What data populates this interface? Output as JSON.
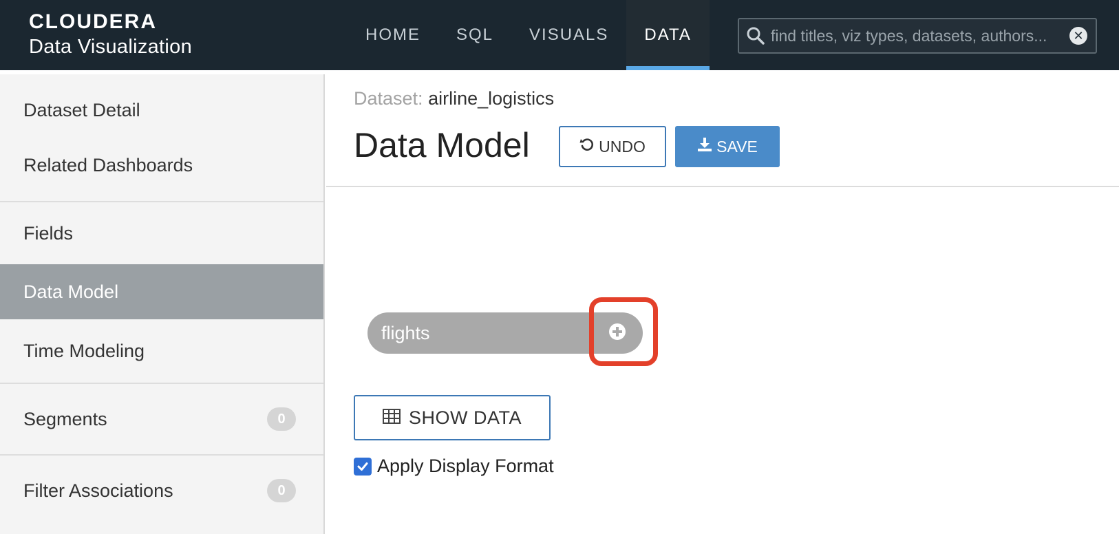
{
  "brand": {
    "logo": "CLOUDERA",
    "product": "Data Visualization"
  },
  "nav": {
    "items": [
      {
        "label": "HOME"
      },
      {
        "label": "SQL"
      },
      {
        "label": "VISUALS"
      },
      {
        "label": "DATA",
        "active": true
      }
    ]
  },
  "search": {
    "placeholder": "find titles, viz types, datasets, authors..."
  },
  "sidebar": {
    "items": [
      {
        "label": "Dataset Detail"
      },
      {
        "label": "Related Dashboards"
      },
      {
        "label": "Fields"
      },
      {
        "label": "Data Model",
        "active": true
      },
      {
        "label": "Time Modeling"
      },
      {
        "label": "Segments",
        "count": "0"
      },
      {
        "label": "Filter Associations",
        "count": "0"
      }
    ]
  },
  "header": {
    "dataset_label": "Dataset:",
    "dataset_name": "airline_logistics",
    "title": "Data Model",
    "undo_label": "UNDO",
    "save_label": "SAVE"
  },
  "model": {
    "table_name": "flights",
    "show_data_label": "SHOW DATA",
    "apply_format_label": "Apply Display Format",
    "apply_format_checked": true
  },
  "colors": {
    "topbar": "#1b2730",
    "accent": "#5aa8e6",
    "primary_button": "#4a8bc9",
    "highlight": "#e3402a"
  }
}
